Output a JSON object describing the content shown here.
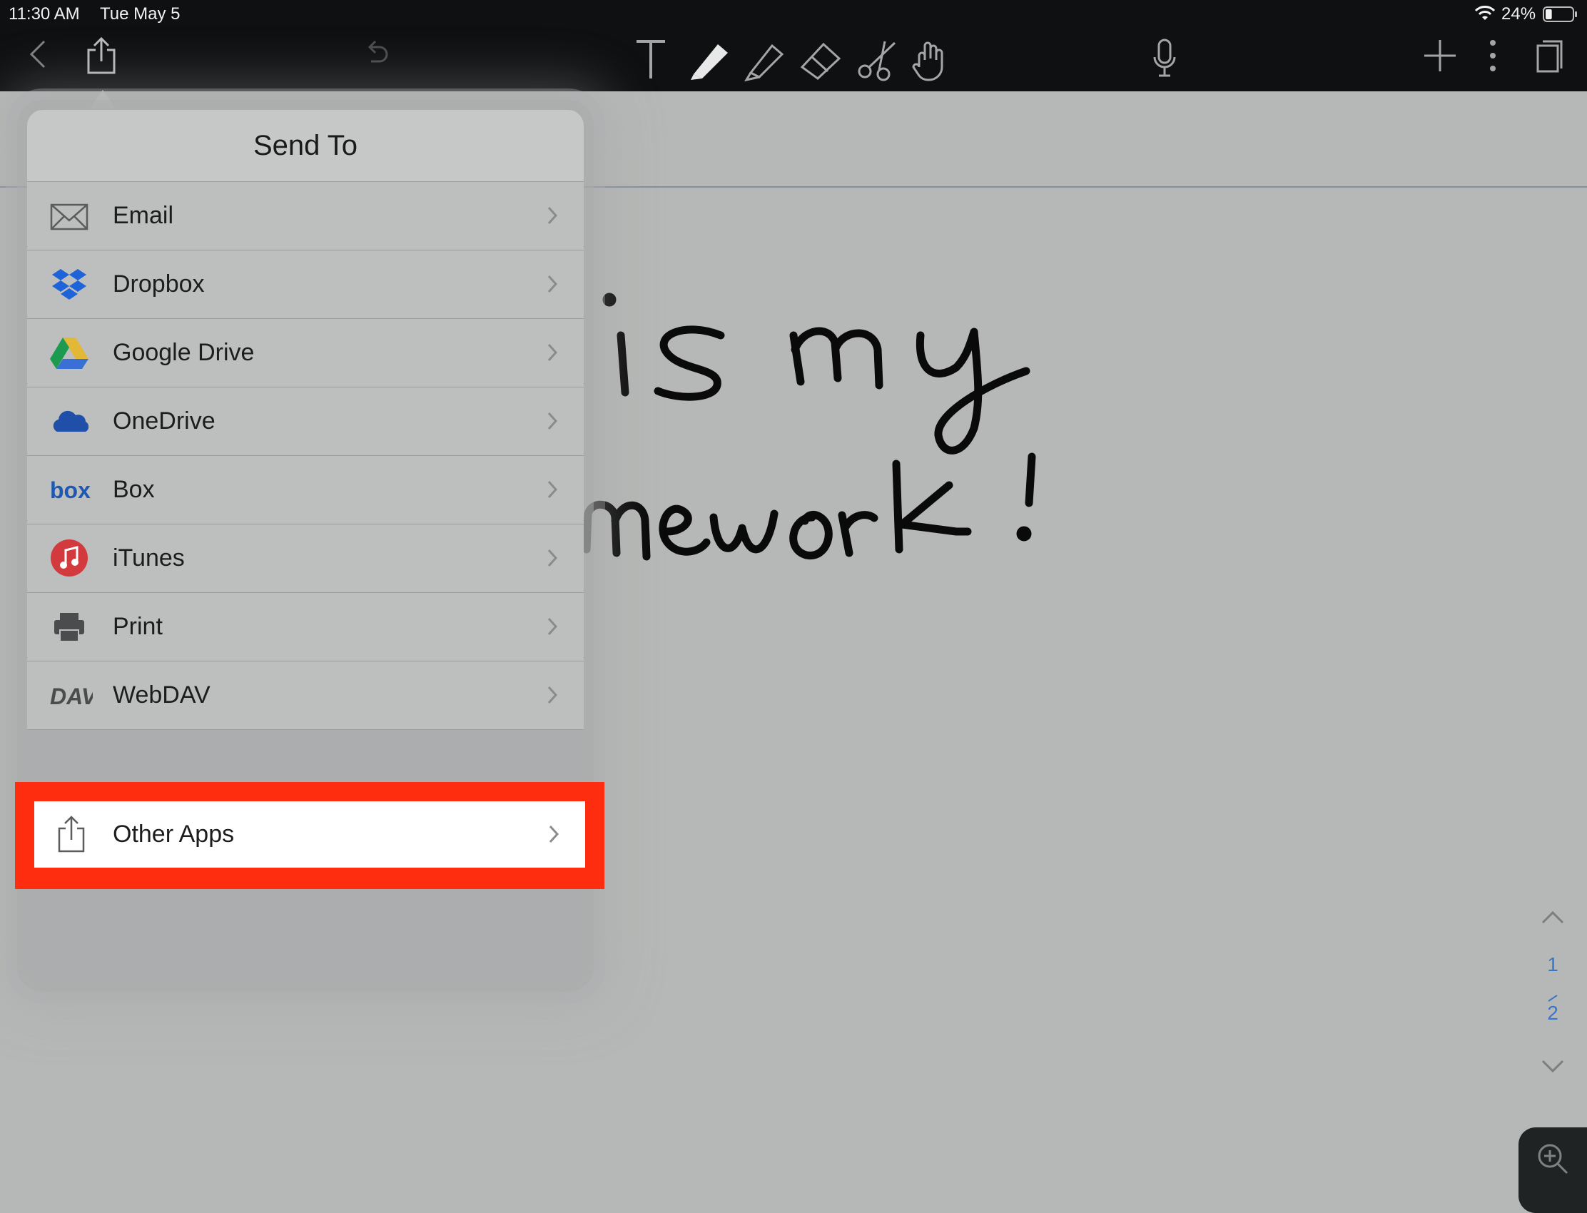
{
  "status_bar": {
    "time": "11:30 AM",
    "date": "Tue May 5",
    "battery_percent": "24%",
    "battery_level": 0.24
  },
  "toolbar": {
    "icons": [
      "back-icon",
      "share-icon",
      "undo-icon",
      "text-tool-icon",
      "pen-icon",
      "highlighter-icon",
      "eraser-icon",
      "scissors-icon",
      "hand-icon",
      "microphone-icon",
      "add-icon",
      "more-icon",
      "pages-icon"
    ]
  },
  "popover": {
    "title": "Send To",
    "items": [
      {
        "label": "Email",
        "icon": "email-icon"
      },
      {
        "label": "Dropbox",
        "icon": "dropbox-icon"
      },
      {
        "label": "Google Drive",
        "icon": "google-drive-icon"
      },
      {
        "label": "OneDrive",
        "icon": "onedrive-icon"
      },
      {
        "label": "Box",
        "icon": "box-icon"
      },
      {
        "label": "iTunes",
        "icon": "itunes-icon"
      },
      {
        "label": "Print",
        "icon": "print-icon"
      },
      {
        "label": "WebDAV",
        "icon": "webdav-icon"
      }
    ],
    "other_apps": {
      "label": "Other Apps",
      "icon": "share-icon"
    },
    "box_logo": "box",
    "webdav_logo": "DAV"
  },
  "page_nav": {
    "current": "1",
    "total": "2"
  },
  "colors": {
    "highlight": "#fe2d0f",
    "toolbar_bg": "#0e1011",
    "page_nav": "#3a76c8"
  }
}
